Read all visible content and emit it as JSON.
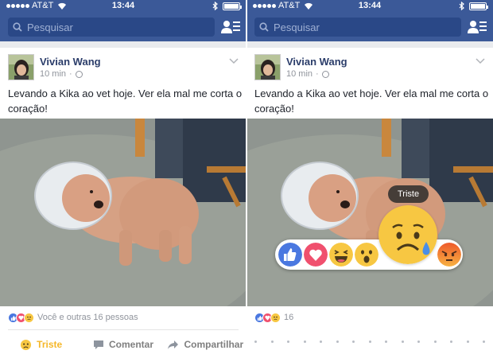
{
  "status": {
    "carrier": "AT&T",
    "time": "13:44"
  },
  "search": {
    "placeholder": "Pesquisar"
  },
  "post": {
    "author": "Vivian Wang",
    "time": "10 min",
    "text": "Levando a Kika ao vet hoje. Ver ela mal me corta o coração!",
    "reactions_summary": "Você e outras 16 pessoas",
    "reactions_count_short": "16"
  },
  "actions": {
    "reaction_label": "Triste",
    "comment_label": "Comentar",
    "share_label": "Compartilhar"
  },
  "reaction_picker": {
    "tooltip": "Triste",
    "items": [
      "like",
      "love",
      "haha",
      "wow",
      "sad",
      "angry"
    ]
  },
  "colors": {
    "brand": "#3b5998",
    "search_bg": "#2a4887",
    "sad_yellow": "#f7c742",
    "love_red": "#f0506e",
    "like_blue": "#4a78e0",
    "angry_red": "#ee5a2b"
  },
  "icons": {
    "search": "search-icon",
    "friends": "friend-requests-icon",
    "privacy": "globe-icon",
    "menu": "chevron-down-icon",
    "comment": "comment-icon",
    "share": "share-icon"
  }
}
